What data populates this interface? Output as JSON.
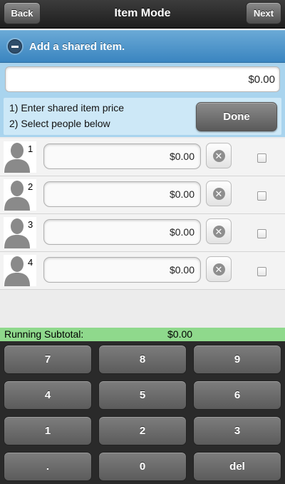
{
  "header": {
    "back_label": "Back",
    "title": "Item Mode",
    "next_label": "Next"
  },
  "shared": {
    "bar_label": "Add a shared item.",
    "price_value": "$0.00",
    "instruction_1": "1) Enter shared item price",
    "instruction_2": "2) Select people below",
    "done_label": "Done"
  },
  "people": [
    {
      "number": "1",
      "amount": "$0.00"
    },
    {
      "number": "2",
      "amount": "$0.00"
    },
    {
      "number": "3",
      "amount": "$0.00"
    },
    {
      "number": "4",
      "amount": "$0.00"
    }
  ],
  "subtotal": {
    "label": "Running Subtotal:",
    "value": "$0.00"
  },
  "keypad": {
    "keys": [
      "7",
      "8",
      "9",
      "4",
      "5",
      "6",
      "1",
      "2",
      "3",
      ".",
      "0",
      "del"
    ]
  },
  "colors": {
    "header_bg": "#2e2e2e",
    "shared_bar": "#4a92c9",
    "shared_panel": "#a9d4ee",
    "subtotal_bg": "#8fd98c",
    "keypad_bg": "#2a2a2a"
  }
}
